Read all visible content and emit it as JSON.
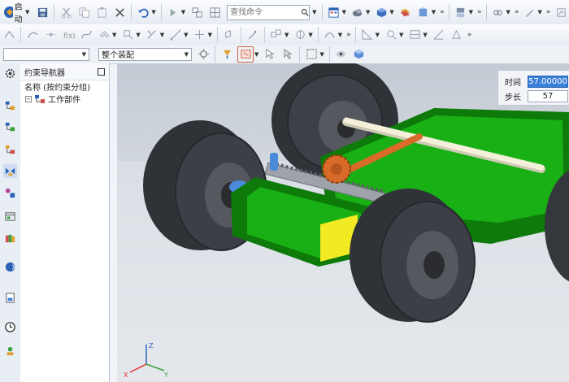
{
  "toolbar": {
    "start_label": "启动",
    "search_placeholder": "查找命令",
    "filter_value": "",
    "assembly_value": "整个装配"
  },
  "navigator": {
    "title": "约束导航器",
    "column_header": "名称 (按约束分组)",
    "tree_items": [
      {
        "label": "工作部件"
      }
    ]
  },
  "simulation": {
    "time_label": "时间",
    "time_value": "57.00000",
    "step_label": "步长",
    "step_value": "57"
  },
  "colors": {
    "body": "#18b014",
    "body_dark": "#0d7a0a",
    "tire": "#3a3d42",
    "block": "#f2ea22",
    "gear": "#d86a2a",
    "axle": "#f4f0da",
    "highlight": "#3a7fd8"
  },
  "axis": {
    "x": "X",
    "y": "Y",
    "z": "Z"
  }
}
